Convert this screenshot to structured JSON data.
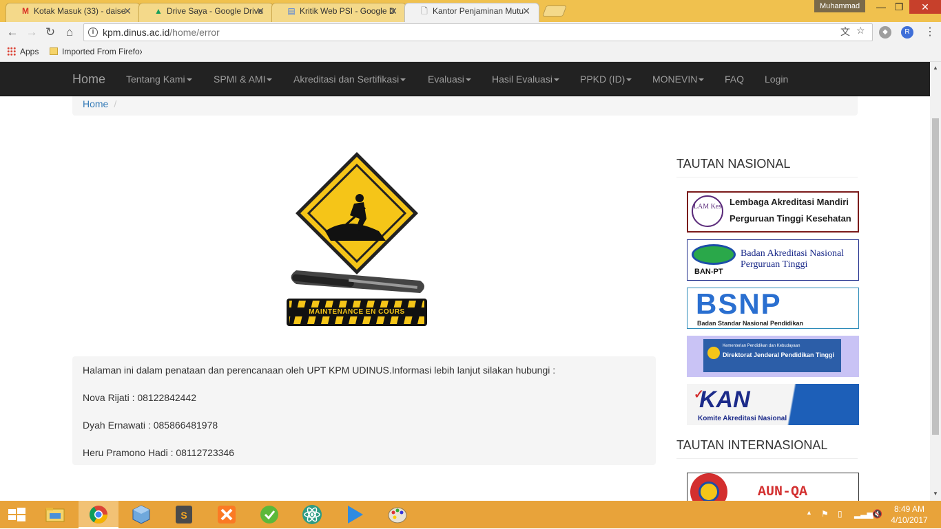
{
  "browser": {
    "tabs": [
      {
        "favicon": "gmail-icon",
        "title": "Kotak Masuk (33) - daise"
      },
      {
        "favicon": "google-drive-icon",
        "title": "Drive Saya - Google Drive"
      },
      {
        "favicon": "google-docs-icon",
        "title": "Kritik Web PSI - Google D"
      },
      {
        "favicon": "page-icon",
        "title": "Kantor Penjaminan Mutu"
      }
    ],
    "profile_name": "Muhammad",
    "url_host": "kpm.dinus.ac.id",
    "url_path": "/home/error",
    "bookmarks": {
      "apps_label": "Apps",
      "folder_label": "Imported From Firefox"
    }
  },
  "site": {
    "nav": {
      "brand": "Home",
      "items": [
        "Tentang Kami",
        "SPMI & AMI",
        "Akreditasi dan Sertifikasi",
        "Evaluasi",
        "Hasil Evaluasi",
        "PPKD (ID)",
        "MONEVIN",
        "FAQ",
        "Login"
      ]
    },
    "breadcrumb": {
      "home": "Home",
      "separator": "/"
    },
    "maintenance_banner": "MAINTENANCE EN COURS",
    "info": {
      "intro": "Halaman ini dalam penataan dan perencanaan oleh UPT KPM UDINUS.Informasi lebih lanjut silakan hubungi :",
      "contacts": [
        "Nova Rijati : 08122842442",
        "Dyah Ernawati : 085866481978",
        "Heru Pramono Hadi : 08112723346"
      ]
    },
    "sidebar": {
      "national_heading": "TAUTAN NASIONAL",
      "international_heading": "TAUTAN INTERNASIONAL",
      "national_links": [
        {
          "logo": "LAM Kes",
          "line1": "Lembaga Akreditasi Mandiri",
          "line2": "Perguruan Tinggi Kesehatan"
        },
        {
          "logo": "BAN-PT",
          "line1": "Badan Akreditasi Nasional",
          "line2": "Perguruan Tinggi"
        },
        {
          "logo": "BSNP",
          "line1": "Badan Standar Nasional Pendidikan"
        },
        {
          "line1": "Kementerian Pendidikan dan Kebudayaan",
          "line2": "Direktorat Jenderal Pendidikan Tinggi"
        },
        {
          "logo": "KAN",
          "line1": "Komite Akreditasi Nasional"
        }
      ],
      "international_links": [
        {
          "logo": "AUN-QA"
        }
      ]
    }
  },
  "taskbar": {
    "time": "8:49 AM",
    "date": "4/10/2017"
  },
  "colors": {
    "tabstrip": "#f0c14e",
    "navbar": "#222222",
    "link": "#337ab7",
    "taskbar": "#e8a33a"
  }
}
